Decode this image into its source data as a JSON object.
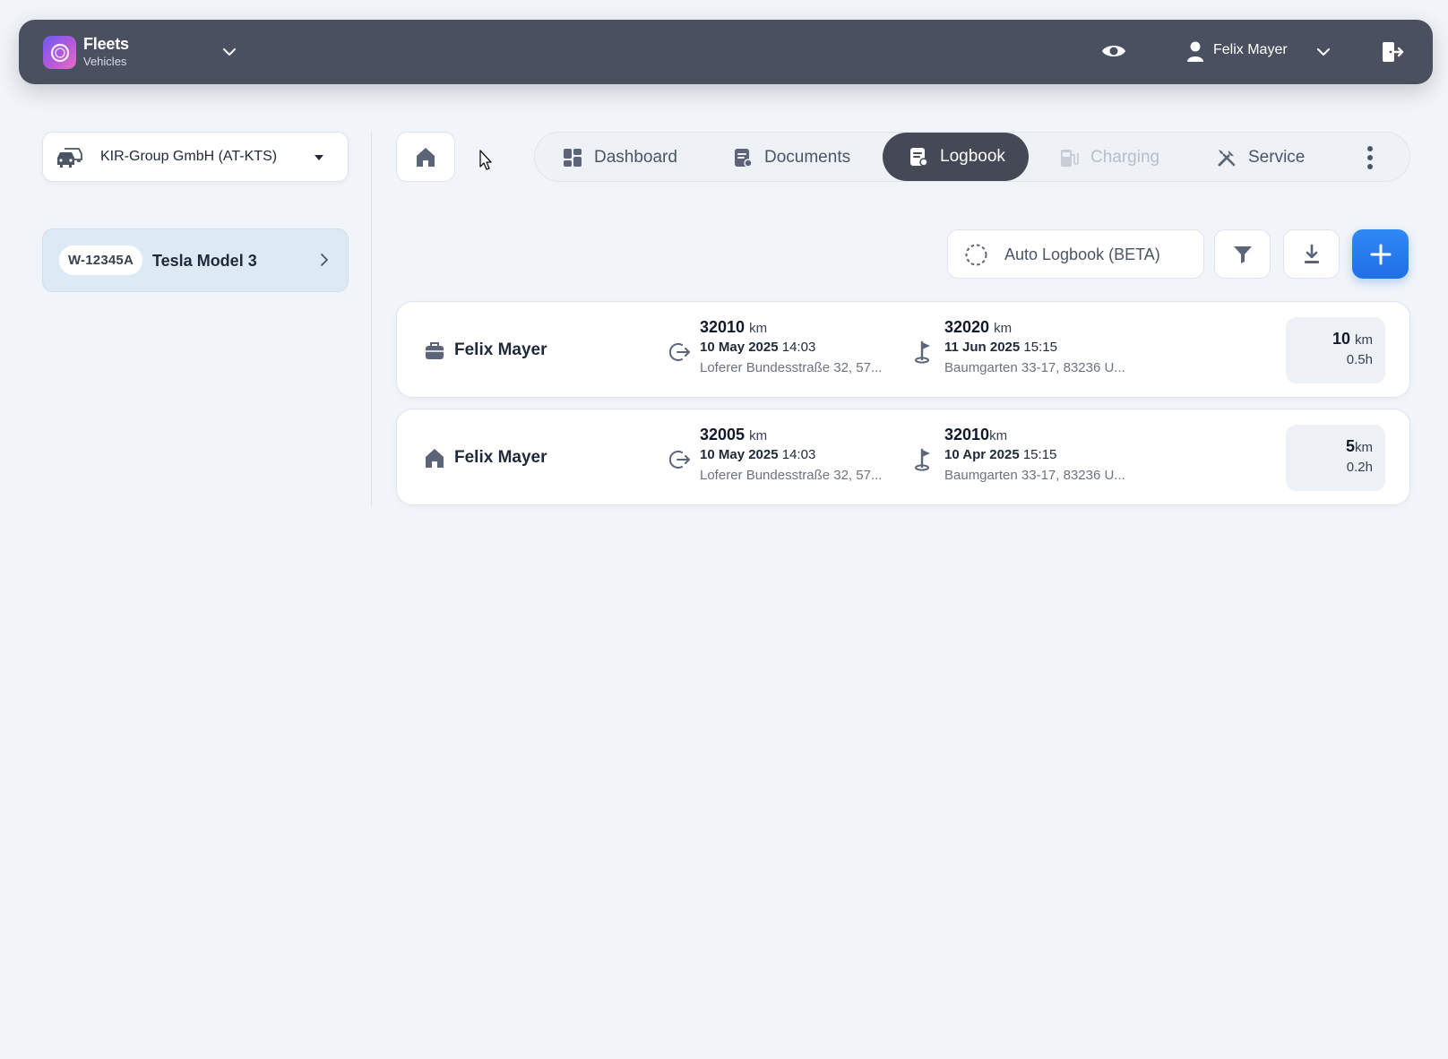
{
  "app": {
    "title": "Fleets",
    "subtitle": "Vehicles"
  },
  "user": {
    "name": "Felix Mayer"
  },
  "company": {
    "name": "KIR-Group GmbH (AT-KTS)"
  },
  "vehicle": {
    "plate": "W-12345A",
    "name": "Tesla Model 3"
  },
  "tabs": [
    {
      "label": "Dashboard",
      "icon": "dashboard-icon",
      "active": false,
      "disabled": false
    },
    {
      "label": "Documents",
      "icon": "documents-icon",
      "active": false,
      "disabled": false
    },
    {
      "label": "Logbook",
      "icon": "logbook-icon",
      "active": true,
      "disabled": false
    },
    {
      "label": "Charging",
      "icon": "charging-icon",
      "active": false,
      "disabled": true
    },
    {
      "label": "Service",
      "icon": "service-icon",
      "active": false,
      "disabled": false
    }
  ],
  "actions": {
    "auto_logbook_label": "Auto Logbook (BETA)"
  },
  "colors": {
    "topbar": "#4b5060",
    "accent": "#1f6fe5",
    "active_tab": "#444955",
    "vehicle_card": "#dde9f5"
  },
  "trips": [
    {
      "driver": "Felix Mayer",
      "type_icon": "briefcase-icon",
      "start_km": "32010",
      "start_unit": "km",
      "start_date": "10 May 2025",
      "start_time": "14:03",
      "start_address": "Loferer Bundesstraße 32, 57...",
      "end_km": "32020",
      "end_unit": "km",
      "end_date": "11 Jun 2025",
      "end_time": "15:15",
      "end_address": "Baumgarten 33-17, 83236 U...",
      "distance": "10",
      "distance_unit": "km",
      "duration": "0.5h"
    },
    {
      "driver": "Felix Mayer",
      "type_icon": "home-icon",
      "start_km": "32005",
      "start_unit": "km",
      "start_date": "10 May 2025",
      "start_time": "14:03",
      "start_address": "Loferer Bundesstraße 32, 57...",
      "end_km": "32010",
      "end_unit": "km",
      "end_date": "10 Apr 2025",
      "end_time": "15:15",
      "end_address": "Baumgarten 33-17, 83236 U...",
      "distance": "5",
      "distance_unit": "km",
      "duration": "0.2h"
    }
  ]
}
